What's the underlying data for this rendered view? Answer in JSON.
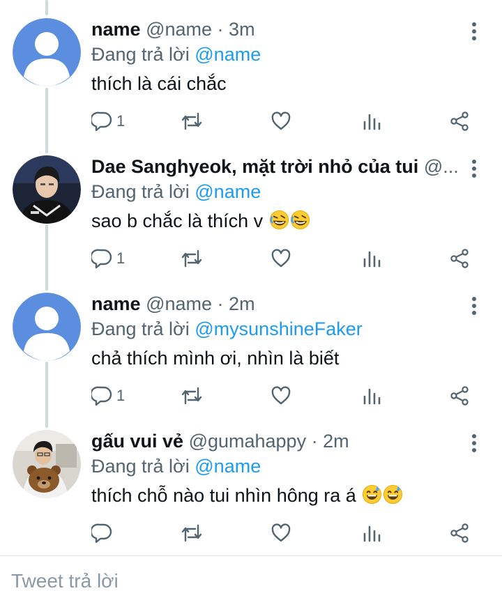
{
  "thread": {
    "tweets": [
      {
        "name": "name",
        "handle": "@name",
        "sep": "·",
        "time": "3m",
        "replying_prefix": "Đang trả lời ",
        "replying_to": "@name",
        "text": "thích là cái chắc",
        "emoji": [],
        "reply_count": "1",
        "avatar": "default-avatar"
      },
      {
        "name": "Dae Sanghyeok, mặt trời nhỏ của tui",
        "handle": "@...",
        "sep": "",
        "time": "",
        "replying_prefix": "Đang trả lời ",
        "replying_to": "@name",
        "text": "sao b chắc là thích v",
        "emoji": [
          "rolling-laughing-emoji",
          "rolling-laughing-emoji"
        ],
        "reply_count": "1",
        "avatar": "photo-avatar-gamer"
      },
      {
        "name": "name",
        "handle": "@name",
        "sep": "·",
        "time": "2m",
        "replying_prefix": "Đang trả lời ",
        "replying_to": "@mysunshineFaker",
        "text": "chả thích mình ơi, nhìn là biết",
        "emoji": [],
        "reply_count": "1",
        "avatar": "default-avatar"
      },
      {
        "name": "gấu vui vẻ",
        "handle": "@gumahappy",
        "sep": "·",
        "time": "2m",
        "replying_prefix": "Đang trả lời ",
        "replying_to": "@name",
        "text": "thích chỗ nào tui nhìn hông ra á",
        "emoji": [
          "sweat-smile-emoji",
          "sweat-smile-emoji"
        ],
        "reply_count": "",
        "avatar": "photo-avatar-bear"
      }
    ]
  },
  "composer": {
    "placeholder": "Tweet trả lời"
  },
  "colors": {
    "link": "#1d9bf0",
    "secondary_text": "#536471",
    "thread_line": "#cfd9de",
    "default_avatar_bg": "#5b8ede"
  },
  "icons": {
    "reply": "reply-icon",
    "retweet": "retweet-icon",
    "like": "heart-icon",
    "views": "analytics-icon",
    "share": "share-icon",
    "more": "more-vertical-icon"
  }
}
